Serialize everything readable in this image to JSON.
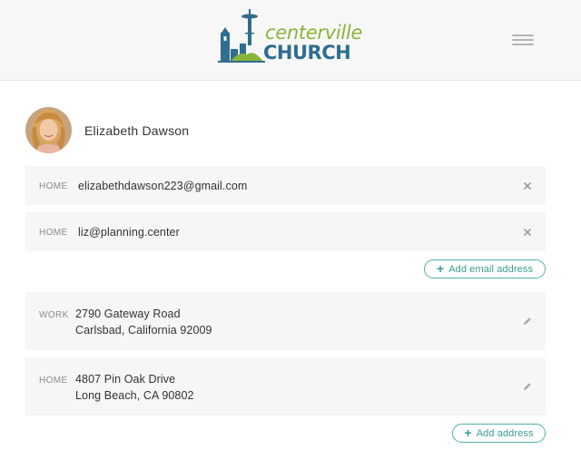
{
  "brand": {
    "line1": "centerville",
    "line2": "CHURCH"
  },
  "header": {
    "menu_icon": "hamburger-menu-icon"
  },
  "profile": {
    "name": "Elizabeth Dawson"
  },
  "emails": [
    {
      "label": "HOME",
      "value": "elizabethdawson223@gmail.com"
    },
    {
      "label": "HOME",
      "value": "liz@planning.center"
    }
  ],
  "add_email_label": "Add email address",
  "addresses": [
    {
      "label": "WORK",
      "line1": "2790 Gateway Road",
      "line2": "Carlsbad, California 92009"
    },
    {
      "label": "HOME",
      "line1": "4807 Pin Oak Drive",
      "line2": "Long Beach, CA 90802"
    }
  ],
  "add_address_label": "Add address",
  "colors": {
    "accent": "#4fb3a8",
    "brand_green": "#8ab43a",
    "brand_blue": "#2f6e8e"
  }
}
